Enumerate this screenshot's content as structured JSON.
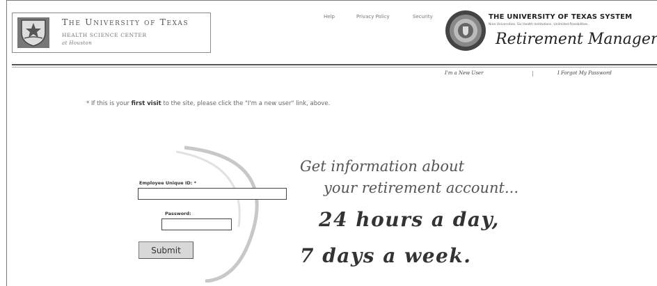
{
  "header": {
    "university_title": "The University of Texas",
    "university_sub1": "Health Science Center",
    "university_sub2": "at Houston",
    "links": {
      "help": "Help",
      "privacy": "Privacy Policy",
      "security": "Security"
    },
    "system_title": "THE UNIVERSITY OF TEXAS SYSTEM",
    "system_tagline": "Nine Universities. Six Health Institutions. Unlimited Possibilities.",
    "app_title": "Retirement Manager"
  },
  "sublinks": {
    "new_user": "I'm a New User",
    "separator": "|",
    "forgot_password": "I Forgot My Password"
  },
  "note": {
    "prefix": "* If this is your ",
    "emphasis": "first visit",
    "suffix": " to the site, please click the \"I'm a new user\" link, above."
  },
  "form": {
    "employee_label": "Employee Unique ID: *",
    "employee_value": "",
    "password_label": "Password:",
    "password_value": "",
    "submit_label": "Submit"
  },
  "slogan": {
    "line1": "Get information about",
    "line2": "your retirement account...",
    "line3": "24 hours a day,",
    "line4": "7 days a week."
  },
  "colors": {
    "rule": "#555555",
    "text": "#333333",
    "button_bg": "#d8d8d8"
  }
}
